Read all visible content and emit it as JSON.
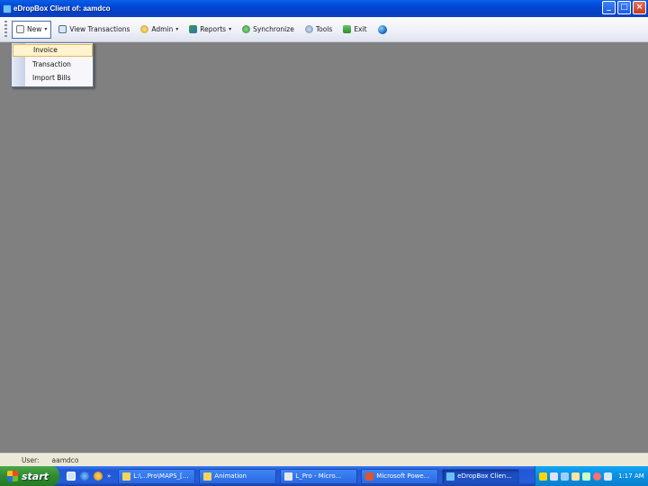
{
  "window": {
    "title": "eDropBox Client of: aamdco",
    "controls": {
      "minimize": "_",
      "maximize": "□",
      "close": "×"
    }
  },
  "toolbar": {
    "items": [
      {
        "label": "New",
        "icon": "new-document-icon",
        "has_dropdown": true
      },
      {
        "label": "View Transactions",
        "icon": "view-transactions-icon"
      },
      {
        "label": "Admin",
        "icon": "admin-gear-icon",
        "has_dropdown": true
      },
      {
        "label": "Reports",
        "icon": "reports-icon",
        "has_dropdown": true
      },
      {
        "label": "Synchronize",
        "icon": "synchronize-icon"
      },
      {
        "label": "Tools",
        "icon": "tools-icon"
      },
      {
        "label": "Exit",
        "icon": "exit-icon"
      }
    ],
    "arrow_glyph": "▾",
    "extra_icon": "globe-icon"
  },
  "new_menu": {
    "items": [
      {
        "label": "Invoice",
        "highlighted": true
      },
      {
        "label": "Transaction",
        "highlighted": false
      },
      {
        "label": "Import Bills",
        "highlighted": false
      }
    ]
  },
  "statusbar": {
    "user_label": "User:",
    "user_value": "aamdco"
  },
  "taskbar": {
    "start_label": "start",
    "quick_launch_more": "»",
    "tasks": [
      {
        "label": "L:\\...Pro\\MAPS_[...",
        "icon": "folder-icon",
        "active": false
      },
      {
        "label": "Animation",
        "icon": "folder-icon",
        "active": false
      },
      {
        "label": "L_Pro - Micro...",
        "icon": "cursor-icon",
        "active": false
      },
      {
        "label": "Microsoft Powe...",
        "icon": "powerpoint-icon",
        "active": false
      },
      {
        "label": "eDropBox Clien...",
        "icon": "edropbox-icon",
        "active": true
      }
    ],
    "clock": "1:17 AM"
  },
  "colors": {
    "title_bar": "#0046d5",
    "workspace": "#808080",
    "taskbar": "#245edb",
    "start_button": "#2f8b2e",
    "menu_highlight": "#fff4cf"
  }
}
